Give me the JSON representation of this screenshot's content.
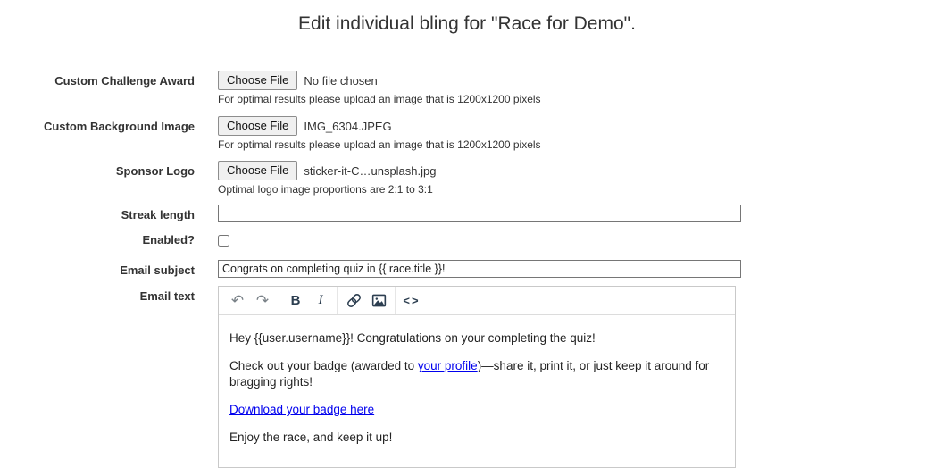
{
  "title": "Edit individual bling for \"Race for Demo\".",
  "colors": {
    "link": "#0000ee",
    "toolbar_icon": "#2c3e50",
    "label_text": "#333333",
    "input_border": "#767676",
    "editor_border": "#c9c9c9"
  },
  "form": {
    "challenge_award": {
      "label": "Custom Challenge Award",
      "button": "Choose File",
      "file": "No file chosen",
      "help": "For optimal results please upload an image that is 1200x1200 pixels"
    },
    "background_image": {
      "label": "Custom Background Image",
      "button": "Choose File",
      "file": "IMG_6304.JPEG",
      "help": "For optimal results please upload an image that is 1200x1200 pixels"
    },
    "sponsor_logo": {
      "label": "Sponsor Logo",
      "button": "Choose File",
      "file": "sticker-it-C…unsplash.jpg",
      "help": "Optimal logo image proportions are 2:1 to 3:1"
    },
    "streak_length": {
      "label": "Streak length",
      "value": ""
    },
    "enabled": {
      "label": "Enabled?",
      "checked": false
    },
    "email_subject": {
      "label": "Email subject",
      "value": "Congrats on completing quiz in {{ race.title }}!"
    },
    "email_text": {
      "label": "Email text",
      "toolbar": {
        "undo": "↶",
        "redo": "↷",
        "bold": "B",
        "italic": "I",
        "code": "<>",
        "icons": [
          "undo-icon",
          "redo-icon",
          "bold-icon",
          "italic-icon",
          "link-icon",
          "image-icon",
          "code-icon"
        ]
      },
      "body": {
        "p1": "Hey {{user.username}}! Congratulations on your completing the quiz!",
        "p2_before": "Check out your badge (awarded to ",
        "p2_link": "your profile",
        "p2_after": ")—share it, print it, or just keep it around for bragging rights!",
        "p3_link": "Download your badge here",
        "p4": "Enjoy the race, and keep it up!"
      }
    }
  }
}
